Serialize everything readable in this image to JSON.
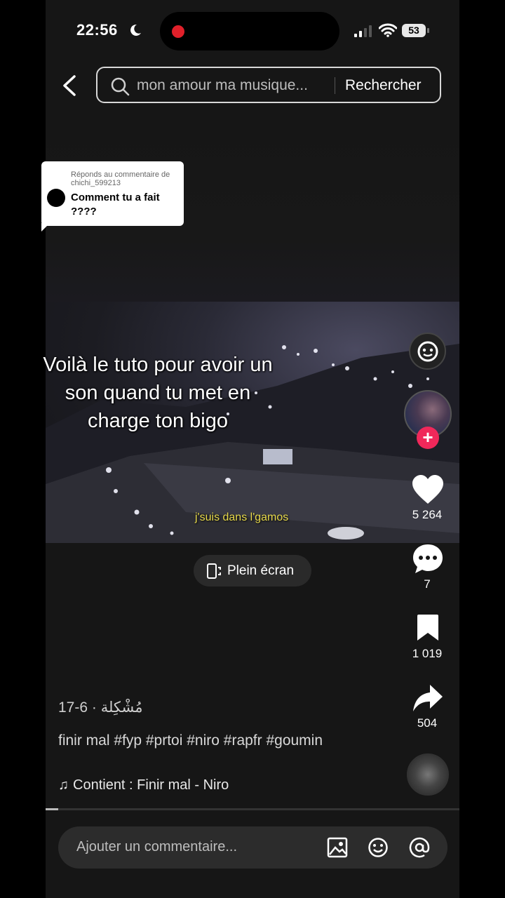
{
  "status_bar": {
    "time": "22:56",
    "battery": "53"
  },
  "search": {
    "query": "mon amour ma musique...",
    "button_label": "Rechercher"
  },
  "reply_bubble": {
    "reply_to": "Réponds au commentaire de chichi_599213",
    "comment": "Comment tu a fait ????"
  },
  "overlay_text": {
    "line1": "Voilà le tuto pour avoir un",
    "line2": "son quand tu met en",
    "line3": "charge ton bigo"
  },
  "video": {
    "subtitle": "j'suis dans l'gamos"
  },
  "fullscreen": {
    "label": "Plein écran"
  },
  "actions": {
    "likes": "5 264",
    "comments": "7",
    "saves": "1 019",
    "shares": "504"
  },
  "post": {
    "author": "مُشْكِلة",
    "date": "· 6-17",
    "caption": "finir mal #fyp #prtoi #niro #rapfr #goumin",
    "music": "Contient : Finir mal - Niro",
    "progress": 0.03
  },
  "comment_bar": {
    "placeholder": "Ajouter un commentaire..."
  },
  "icons": [
    "moon-icon",
    "back-icon",
    "search-icon",
    "mention-circle-icon",
    "heart-icon",
    "comment-icon",
    "bookmark-icon",
    "share-icon",
    "image-icon",
    "emoji-icon",
    "at-icon"
  ]
}
